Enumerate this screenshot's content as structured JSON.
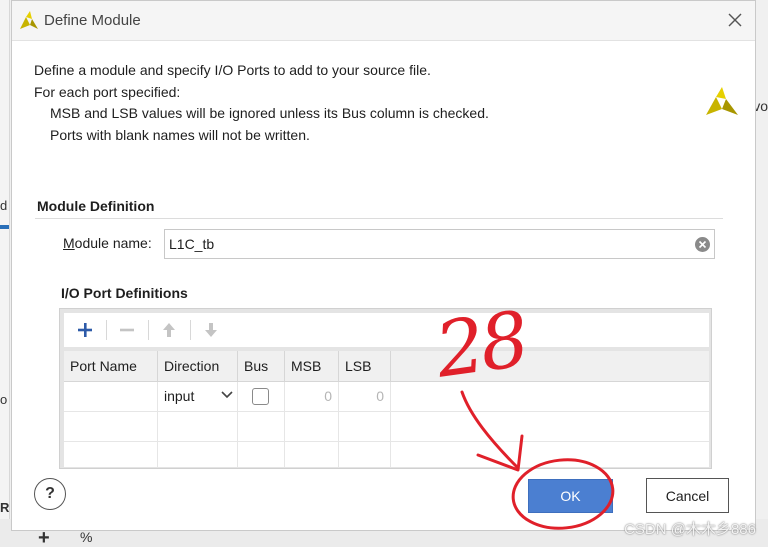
{
  "dialog": {
    "title": "Define Module",
    "intro": {
      "line1": "Define a module and specify I/O Ports to add to your source file.",
      "line2": "For each port specified:",
      "line3": "MSB and LSB values will be ignored unless its Bus column is checked.",
      "line4": "Ports with blank names will not be written."
    },
    "module_definition": {
      "section_title": "Module Definition",
      "name_label_mnemonic": "M",
      "name_label_rest": "odule name:",
      "name_value": "L1C_tb"
    },
    "io_ports": {
      "section_title": "I/O Port Definitions",
      "columns": [
        "Port Name",
        "Direction",
        "Bus",
        "MSB",
        "LSB"
      ],
      "rows": [
        {
          "port_name": "",
          "direction": "input",
          "bus": false,
          "msb": "0",
          "lsb": "0"
        }
      ]
    },
    "buttons": {
      "help": "?",
      "ok": "OK",
      "cancel": "Cancel"
    }
  },
  "annotation": {
    "number": "28",
    "color": "#e0202a"
  },
  "background_fragments": {
    "left_d": "d",
    "left_o": "o",
    "left_R": "R",
    "right_vo": "vo",
    "bottom_plus": "+",
    "bottom_pct": "%"
  },
  "watermark": "CSDN @木木乡886",
  "colors": {
    "ok_button": "#4b7fd1",
    "accent_logo": "#c8b400"
  }
}
